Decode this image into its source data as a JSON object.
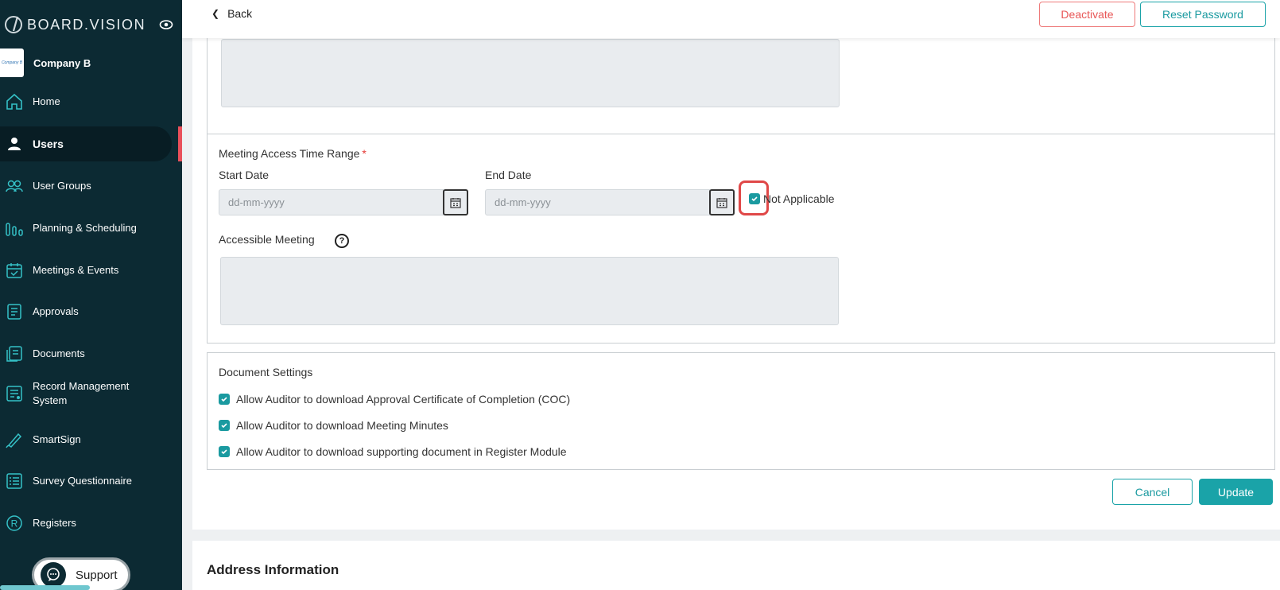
{
  "brand": {
    "name": "BOARD.VISION"
  },
  "company": {
    "name": "Company B",
    "logo_text": "Company B"
  },
  "sidebar": {
    "items": [
      {
        "label": "Home",
        "icon": "home-icon"
      },
      {
        "label": "Users",
        "icon": "user-icon",
        "active": true
      },
      {
        "label": "User Groups",
        "icon": "user-groups-icon"
      },
      {
        "label": "Planning & Scheduling",
        "icon": "bar-chart-icon"
      },
      {
        "label": "Meetings & Events",
        "icon": "calendar-check-icon"
      },
      {
        "label": "Approvals",
        "icon": "document-icon"
      },
      {
        "label": "Documents",
        "icon": "documents-icon"
      },
      {
        "label": "Record Management System",
        "icon": "record-icon"
      },
      {
        "label": "SmartSign",
        "icon": "pen-icon"
      },
      {
        "label": "Survey Questionnaire",
        "icon": "survey-icon"
      },
      {
        "label": "Registers",
        "icon": "registered-icon"
      }
    ],
    "support_label": "Support"
  },
  "header": {
    "back_label": "Back",
    "deactivate_label": "Deactivate",
    "reset_password_label": "Reset Password"
  },
  "meeting_access": {
    "title": "Meeting Access Time Range",
    "required_mark": "*",
    "start_label": "Start Date",
    "start_placeholder": "dd-mm-yyyy",
    "end_label": "End Date",
    "end_placeholder": "dd-mm-yyyy",
    "not_applicable_label": "Not Applicable",
    "not_applicable_checked": true,
    "accessible_meeting_label": "Accessible Meeting",
    "help_glyph": "?"
  },
  "document_settings": {
    "title": "Document Settings",
    "options": [
      {
        "label": "Allow Auditor to download Approval Certificate of Completion (COC)",
        "checked": true
      },
      {
        "label": "Allow Auditor to download Meeting Minutes",
        "checked": true
      },
      {
        "label": "Allow Auditor to download supporting document in Register Module",
        "checked": true
      }
    ]
  },
  "actions": {
    "cancel_label": "Cancel",
    "update_label": "Update"
  },
  "address": {
    "title": "Address Information"
  },
  "colors": {
    "sidebar_bg": "#0c2a33",
    "accent": "#1aa3a8",
    "danger": "#e85757"
  }
}
